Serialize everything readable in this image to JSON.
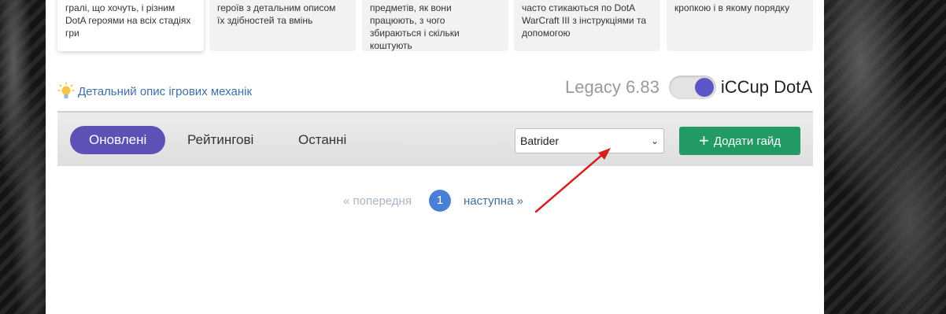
{
  "cards": [
    {
      "lines": [
        "гралі, що хочуть, і різним",
        "DotA героями на всіх стадіях",
        "гри"
      ]
    },
    {
      "lines": [
        "героїв з детальним описом",
        "їх здібностей та вмінь"
      ]
    },
    {
      "lines": [
        "предметів, як вони",
        "працюють, з чого",
        "збираються і скільки",
        "коштують"
      ]
    },
    {
      "lines": [
        "часто стикаються по DotA",
        "WarCraft III з інструкціями та",
        "допомогою"
      ]
    },
    {
      "lines": [
        "кропкою і в якому порядку"
      ]
    }
  ],
  "mechanics_link": "Детальний опис ігрових механік",
  "version": {
    "legacy": "Legacy 6.83",
    "iccup": "iCCup DotA"
  },
  "tabs": [
    {
      "label": "Оновлені",
      "active": true
    },
    {
      "label": "Рейтингові",
      "active": false
    },
    {
      "label": "Останні",
      "active": false
    }
  ],
  "hero_select": {
    "value": "Batrider"
  },
  "add_guide_button": "Додати гайд",
  "pagination": {
    "prev": "« попередня",
    "current": "1",
    "next": "наступна »"
  },
  "colors": {
    "accent": "#5c52b6",
    "add_button": "#229a63",
    "link": "#3f6fa8",
    "page_badge": "#4a7fd6",
    "annotation_arrow": "#d62020"
  }
}
